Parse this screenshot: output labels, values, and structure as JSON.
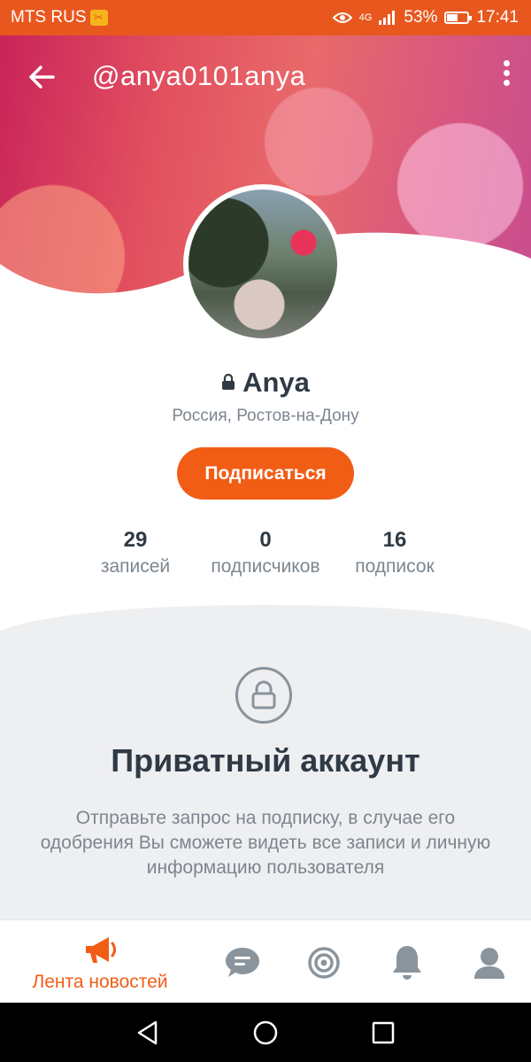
{
  "status_bar": {
    "carrier": "MTS RUS",
    "network": "4G",
    "battery_percent": "53%",
    "battery_level": 0.53,
    "time": "17:41"
  },
  "header": {
    "username": "@anya0101anya",
    "back_icon": "arrow-left-icon",
    "menu_icon": "more-vertical-icon"
  },
  "profile": {
    "name": "Anya",
    "location": "Россия, Ростов-на-Дону",
    "subscribe_label": "Подписаться"
  },
  "stats": [
    {
      "count": "29",
      "label": "записей"
    },
    {
      "count": "0",
      "label": "подписчиков"
    },
    {
      "count": "16",
      "label": "подписок"
    }
  ],
  "private": {
    "title": "Приватный аккаунт",
    "text": "Отправьте запрос на подписку, в случае его одобрения Вы сможете видеть все записи и личную информацию пользователя"
  },
  "bottom_nav": {
    "feed_label": "Лента новостей",
    "items": [
      "megaphone-icon",
      "chat-icon",
      "target-icon",
      "bell-icon",
      "user-icon"
    ]
  },
  "colors": {
    "accent": "#f25d16",
    "status_bar": "#e8581e",
    "text_dark": "#2f3a45",
    "text_muted": "#7c868f"
  }
}
